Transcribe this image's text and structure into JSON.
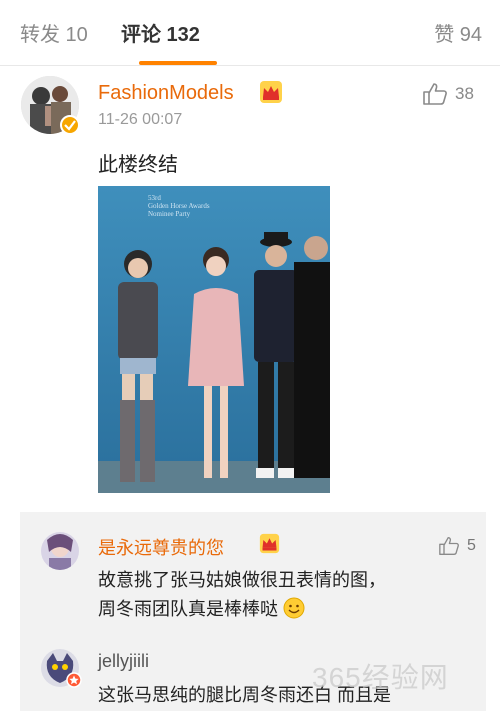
{
  "tabs": {
    "reposts": "转发 10",
    "comments": "评论 132",
    "likes": "赞 94"
  },
  "main_comment": {
    "author": "FashionModels",
    "timestamp": "11-26 00:07",
    "text": "此楼终结",
    "like_count": "38",
    "photo_caption_line1": "53rd",
    "photo_caption_line2": "Golden Horse Awards",
    "photo_caption_line3": "Nominee Party"
  },
  "replies": [
    {
      "author": "是永远尊贵的您",
      "like_count": "5",
      "text_line1": "故意挑了张马姑娘做很丑表情的图，",
      "text_line2": "周冬雨团队真是棒棒哒"
    },
    {
      "author": "jellyjiili",
      "text_line1": "这张马思纯的腿比周冬雨还白 而且是"
    }
  ],
  "watermark": "365经验网",
  "colors": {
    "accent": "#ff8200",
    "username": "#e96a0a",
    "reply_bg": "#f2f2f2"
  }
}
